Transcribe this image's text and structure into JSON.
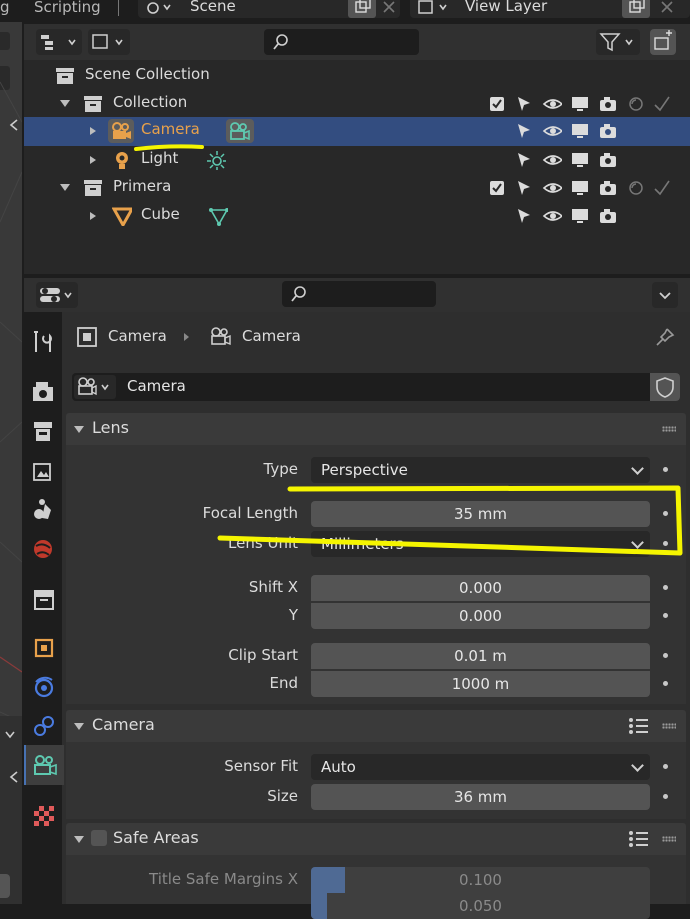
{
  "topbar": {
    "left_char": "g",
    "workspace_tab": "Scripting",
    "scene_name": "Scene",
    "view_layer_name": "View Layer"
  },
  "outliner": {
    "rows": [
      {
        "label": "Scene Collection"
      },
      {
        "label": "Collection"
      },
      {
        "label": "Camera"
      },
      {
        "label": "Light"
      },
      {
        "label": "Primera"
      },
      {
        "label": "Cube"
      }
    ]
  },
  "properties": {
    "breadcrumb": {
      "object": "Camera",
      "data": "Camera"
    },
    "datablock_name": "Camera",
    "lens_panel": {
      "title": "Lens",
      "type_label": "Type",
      "type_value": "Perspective",
      "focal_label": "Focal Length",
      "focal_value": "35 mm",
      "unit_label": "Lens Unit",
      "unit_value": "Millimeters",
      "shiftx_label": "Shift X",
      "shiftx_value": "0.000",
      "shifty_label": "Y",
      "shifty_value": "0.000",
      "clipstart_label": "Clip Start",
      "clipstart_value": "0.01 m",
      "clipend_label": "End",
      "clipend_value": "1000 m"
    },
    "camera_panel": {
      "title": "Camera",
      "sensorfit_label": "Sensor Fit",
      "sensorfit_value": "Auto",
      "size_label": "Size",
      "size_value": "36 mm"
    },
    "safe_areas_panel": {
      "title": "Safe Areas",
      "title_margin_x_label": "Title Safe Margins X",
      "title_margin_x_value": 0.1,
      "title_margin_x_text": "0.100",
      "next_value_text": "0.050"
    }
  },
  "colors": {
    "selected_row": "#334d80",
    "camera_orange": "#e8a14b",
    "object_data_green": "#5ec9b0",
    "annotation_yellow": "#f5f500",
    "panel_bg": "#333333"
  }
}
